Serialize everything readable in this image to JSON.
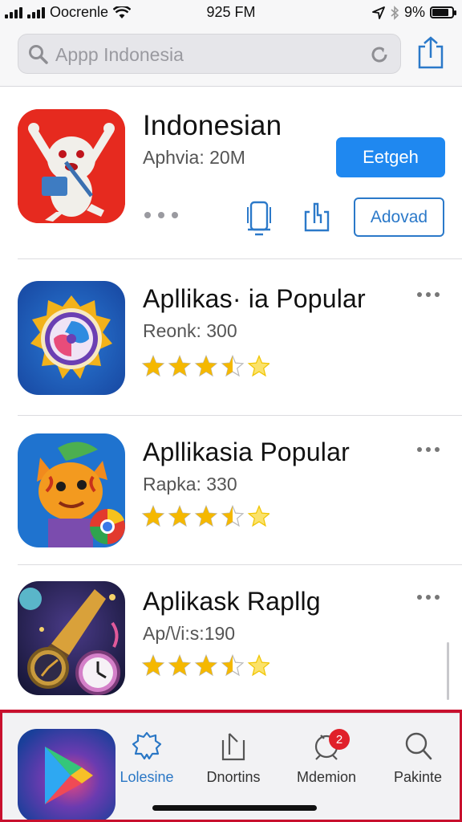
{
  "status_bar": {
    "carrier": "Oocrenle",
    "time": "925 FM",
    "battery": "9%",
    "battery_level": 0.85
  },
  "search": {
    "placeholder": "Appp Indonesia"
  },
  "featured": {
    "title": "Indonesian",
    "meta": "Aphvia: 20M",
    "get_label": "Eetgeh",
    "download_label": "Adovad"
  },
  "apps": [
    {
      "title": "Apllikas· ia Popular",
      "meta": "Reonk: 300",
      "rating": 3.5
    },
    {
      "title": "Apllikasia Popular",
      "meta": "Rapka: 330",
      "rating": 3.5
    },
    {
      "title": "Aplikask Rapllg",
      "meta": "Ap/\\/i:s:190",
      "rating": 3.5
    }
  ],
  "tabs": [
    {
      "label": "Lolesine",
      "icon": "badge-star-icon",
      "active": true
    },
    {
      "label": "Dnortins",
      "icon": "download-tray-icon",
      "active": false
    },
    {
      "label": "Mdemion",
      "icon": "notification-icon",
      "active": false,
      "badge": "2"
    },
    {
      "label": "Pakinte",
      "icon": "search-icon",
      "active": false
    }
  ],
  "colors": {
    "accent": "#1f88f0",
    "link": "#2b79c9",
    "star": "#f5b800",
    "badge": "#e0202a",
    "frame": "#c8102e"
  }
}
